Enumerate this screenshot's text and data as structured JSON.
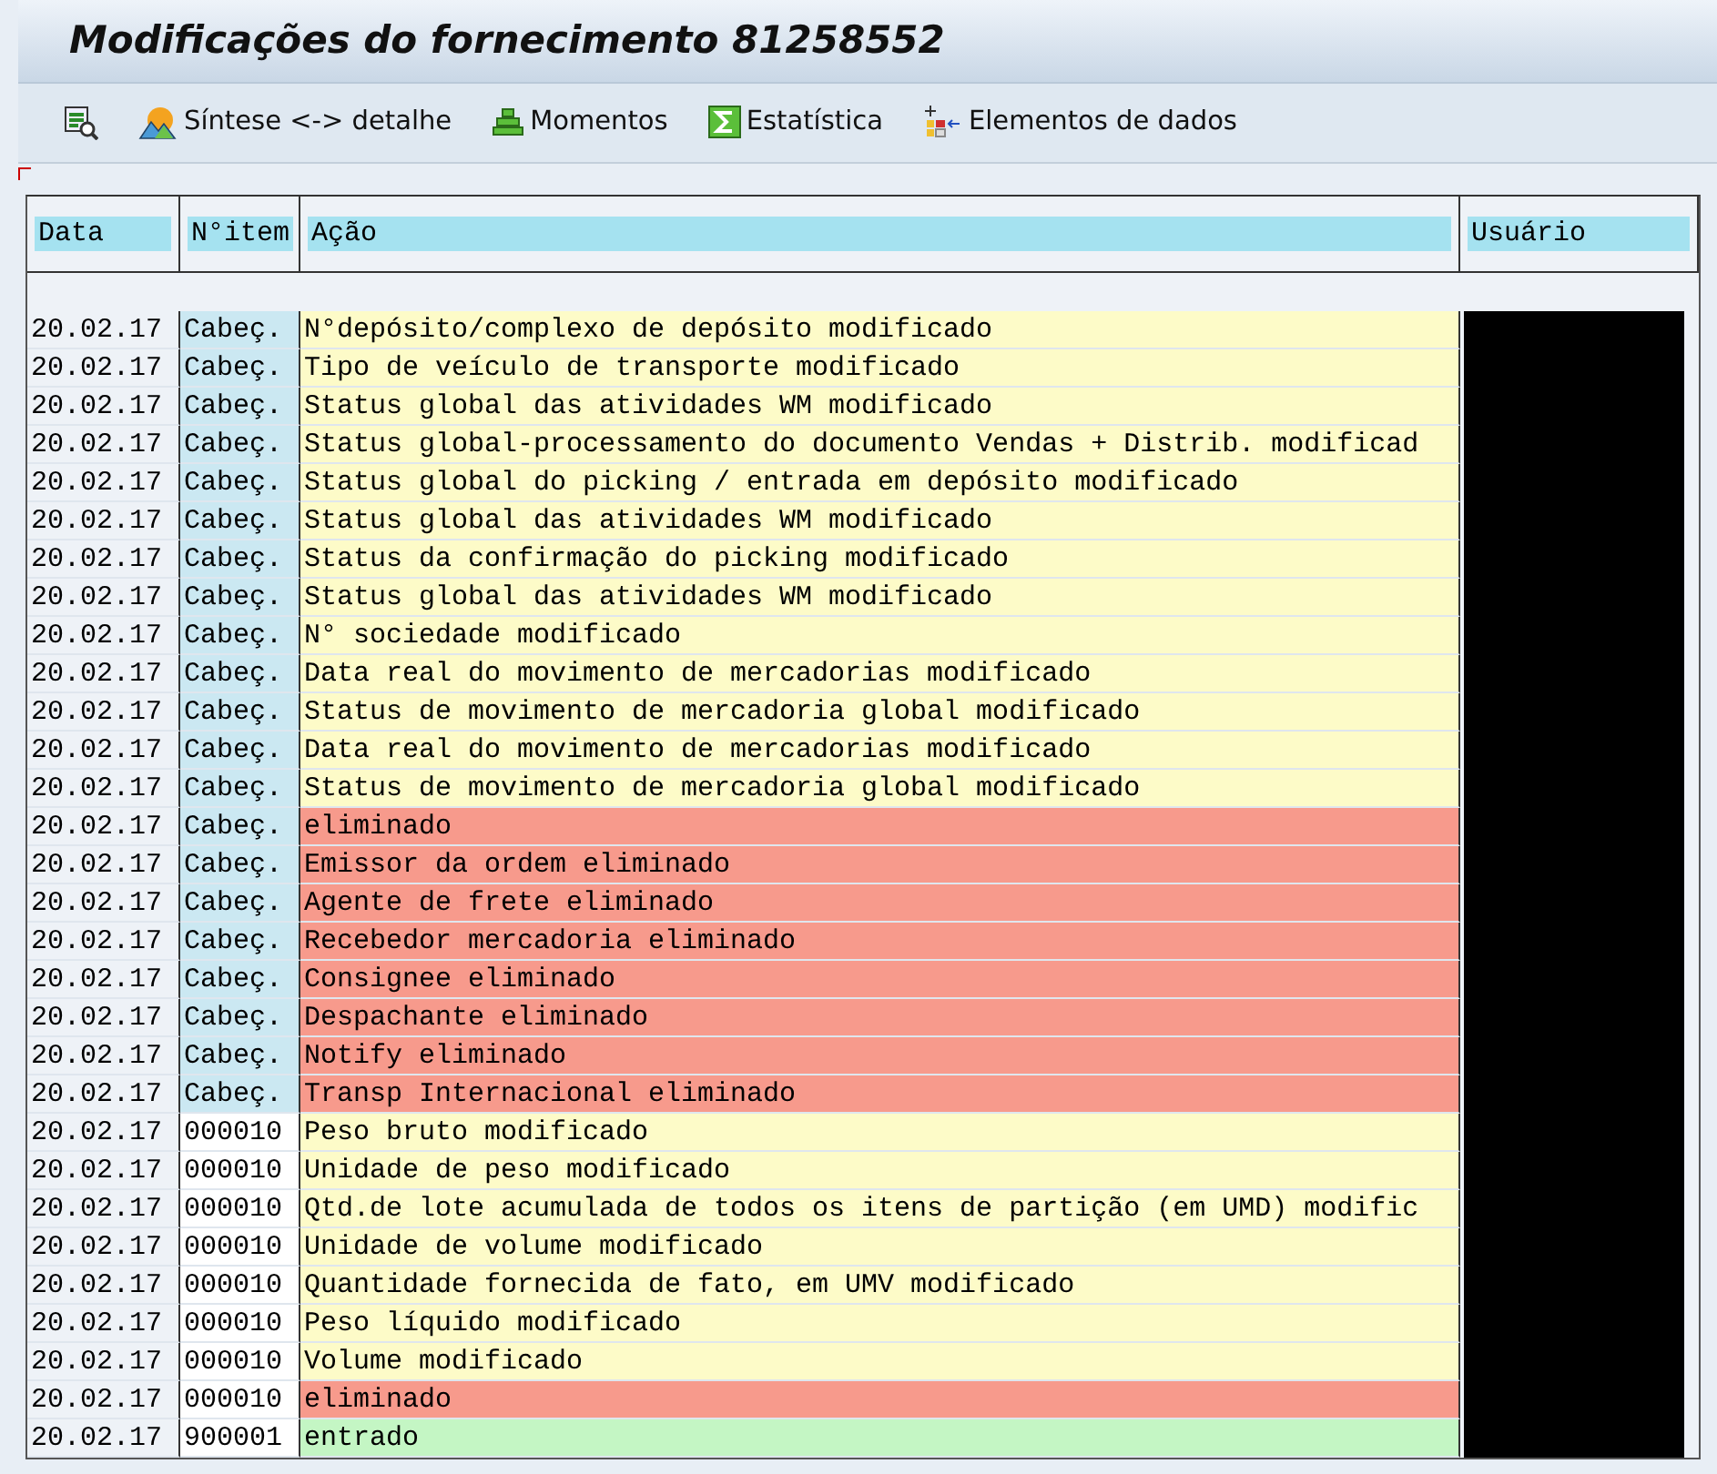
{
  "window": {
    "title": "Modificações do fornecimento 81258552"
  },
  "toolbar": [
    {
      "kind": "display"
    },
    {
      "kind": "overview",
      "label": "Síntese <-> detalhe"
    },
    {
      "kind": "moments",
      "label": "Momentos"
    },
    {
      "kind": "sum",
      "label": "Estatística"
    },
    {
      "kind": "fields",
      "label": "Elementos de dados"
    }
  ],
  "table": {
    "columns": [
      "Data",
      "N°item",
      "Ação",
      "Usuário"
    ],
    "rows": [
      {
        "date": "20.02.17",
        "item": "Cabeç.",
        "header": true,
        "action": "N°depósito/complexo de depósito modificado",
        "color": "#fdfbc8"
      },
      {
        "date": "20.02.17",
        "item": "Cabeç.",
        "header": true,
        "action": "Tipo de veículo de transporte modificado",
        "color": "#fdfbc8"
      },
      {
        "date": "20.02.17",
        "item": "Cabeç.",
        "header": true,
        "action": "Status global das atividades WM modificado",
        "color": "#fdfbc8"
      },
      {
        "date": "20.02.17",
        "item": "Cabeç.",
        "header": true,
        "action": "Status global-processamento do documento Vendas + Distrib. modificad",
        "color": "#fdfbc8"
      },
      {
        "date": "20.02.17",
        "item": "Cabeç.",
        "header": true,
        "action": "Status global do picking / entrada em depósito modificado",
        "color": "#fdfbc8"
      },
      {
        "date": "20.02.17",
        "item": "Cabeç.",
        "header": true,
        "action": "Status global das atividades WM modificado",
        "color": "#fdfbc8"
      },
      {
        "date": "20.02.17",
        "item": "Cabeç.",
        "header": true,
        "action": "Status da confirmação do picking modificado",
        "color": "#fdfbc8"
      },
      {
        "date": "20.02.17",
        "item": "Cabeç.",
        "header": true,
        "action": "Status global das atividades WM modificado",
        "color": "#fdfbc8"
      },
      {
        "date": "20.02.17",
        "item": "Cabeç.",
        "header": true,
        "action": "N° sociedade modificado",
        "color": "#fdfbc8"
      },
      {
        "date": "20.02.17",
        "item": "Cabeç.",
        "header": true,
        "action": "Data real do movimento de mercadorias modificado",
        "color": "#fdfbc8"
      },
      {
        "date": "20.02.17",
        "item": "Cabeç.",
        "header": true,
        "action": "Status de movimento de mercadoria global modificado",
        "color": "#fdfbc8"
      },
      {
        "date": "20.02.17",
        "item": "Cabeç.",
        "header": true,
        "action": "Data real do movimento de mercadorias modificado",
        "color": "#fdfbc8"
      },
      {
        "date": "20.02.17",
        "item": "Cabeç.",
        "header": true,
        "action": "Status de movimento de mercadoria global modificado",
        "color": "#fdfbc8"
      },
      {
        "date": "20.02.17",
        "item": "Cabeç.",
        "header": true,
        "action": "eliminado",
        "color": "#f79a8c"
      },
      {
        "date": "20.02.17",
        "item": "Cabeç.",
        "header": true,
        "action": "Emissor da ordem eliminado",
        "color": "#f79a8c"
      },
      {
        "date": "20.02.17",
        "item": "Cabeç.",
        "header": true,
        "action": "Agente de frete eliminado",
        "color": "#f79a8c"
      },
      {
        "date": "20.02.17",
        "item": "Cabeç.",
        "header": true,
        "action": "Recebedor mercadoria eliminado",
        "color": "#f79a8c"
      },
      {
        "date": "20.02.17",
        "item": "Cabeç.",
        "header": true,
        "action": "Consignee eliminado",
        "color": "#f79a8c"
      },
      {
        "date": "20.02.17",
        "item": "Cabeç.",
        "header": true,
        "action": "Despachante eliminado",
        "color": "#f79a8c"
      },
      {
        "date": "20.02.17",
        "item": "Cabeç.",
        "header": true,
        "action": "Notify eliminado",
        "color": "#f79a8c"
      },
      {
        "date": "20.02.17",
        "item": "Cabeç.",
        "header": true,
        "action": "Transp Internacional eliminado",
        "color": "#f79a8c"
      },
      {
        "date": "20.02.17",
        "item": "000010",
        "header": false,
        "action": "Peso bruto modificado",
        "color": "#fdfbc8"
      },
      {
        "date": "20.02.17",
        "item": "000010",
        "header": false,
        "action": "Unidade de peso modificado",
        "color": "#fdfbc8"
      },
      {
        "date": "20.02.17",
        "item": "000010",
        "header": false,
        "action": "Qtd.de lote acumulada de todos os itens de partição (em UMD) modific",
        "color": "#fdfbc8"
      },
      {
        "date": "20.02.17",
        "item": "000010",
        "header": false,
        "action": "Unidade de volume modificado",
        "color": "#fdfbc8"
      },
      {
        "date": "20.02.17",
        "item": "000010",
        "header": false,
        "action": "Quantidade fornecida de fato, em UMV modificado",
        "color": "#fdfbc8"
      },
      {
        "date": "20.02.17",
        "item": "000010",
        "header": false,
        "action": "Peso líquido modificado",
        "color": "#fdfbc8"
      },
      {
        "date": "20.02.17",
        "item": "000010",
        "header": false,
        "action": "Volume modificado",
        "color": "#fdfbc8"
      },
      {
        "date": "20.02.17",
        "item": "000010",
        "header": false,
        "action": "eliminado",
        "color": "#f79a8c"
      },
      {
        "date": "20.02.17",
        "item": "900001",
        "header": false,
        "action": "entrado",
        "color": "#c4f6c4"
      }
    ]
  }
}
